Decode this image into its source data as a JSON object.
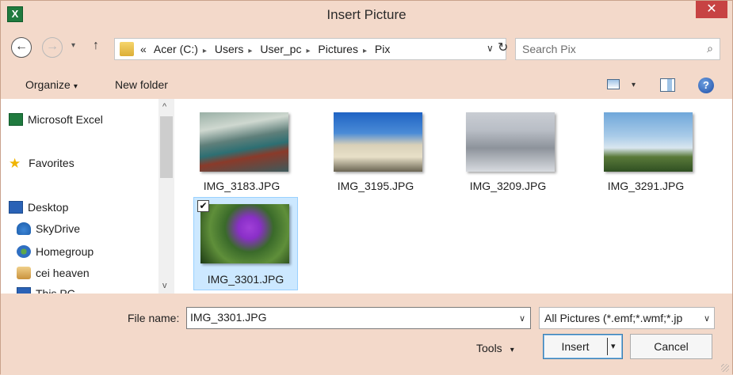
{
  "window": {
    "title": "Insert Picture",
    "close_glyph": "✕",
    "app_icon_letter": "X"
  },
  "nav": {
    "back_glyph": "←",
    "forward_glyph": "→",
    "history_glyph": "▾",
    "up_glyph": "↑",
    "overflow_glyph": "«",
    "breadcrumbs": [
      "Acer (C:)",
      "Users",
      "User_pc",
      "Pictures",
      "Pix"
    ],
    "crumb_separator": "▸",
    "refresh_glyph": "↻",
    "dropdown_glyph": "∨"
  },
  "search": {
    "placeholder": "Search Pix",
    "icon_glyph": "⌕"
  },
  "toolbar": {
    "organize_label": "Organize",
    "new_folder_label": "New folder",
    "caret": "▾",
    "help_glyph": "?"
  },
  "navpane": {
    "items": [
      {
        "label": "Microsoft Excel",
        "icon": "excel-icon"
      },
      {
        "label": "Favorites",
        "icon": "star-icon"
      },
      {
        "label": "Desktop",
        "icon": "desktop-icon"
      },
      {
        "label": "SkyDrive",
        "icon": "skydrive-icon"
      },
      {
        "label": "Homegroup",
        "icon": "homegroup-icon"
      },
      {
        "label": "cei heaven",
        "icon": "user-folder-icon"
      },
      {
        "label": "This PC",
        "icon": "computer-icon"
      }
    ],
    "scroll_up_glyph": "^",
    "scroll_down_glyph": "v",
    "star_glyph": "★"
  },
  "files": [
    {
      "name": "IMG_3183.JPG",
      "selected": false
    },
    {
      "name": "IMG_3195.JPG",
      "selected": false
    },
    {
      "name": "IMG_3209.JPG",
      "selected": false
    },
    {
      "name": "IMG_3291.JPG",
      "selected": false
    },
    {
      "name": "IMG_3301.JPG",
      "selected": true
    }
  ],
  "check_glyph": "✔",
  "bottom": {
    "file_name_label": "File name:",
    "file_name_value": "IMG_3301.JPG",
    "file_type_value": "All Pictures (*.emf;*.wmf;*.jp",
    "dropdown_glyph": "∨",
    "tools_label": "Tools",
    "tools_caret": "▾",
    "insert_label": "Insert",
    "insert_arrow": "▾",
    "cancel_label": "Cancel"
  },
  "colors": {
    "title_bar": "#f3d9ca",
    "close_button": "#c74343",
    "selection_fill": "#cce8ff",
    "selection_border": "#99d1ff",
    "default_button_border": "#3c7fb1"
  }
}
